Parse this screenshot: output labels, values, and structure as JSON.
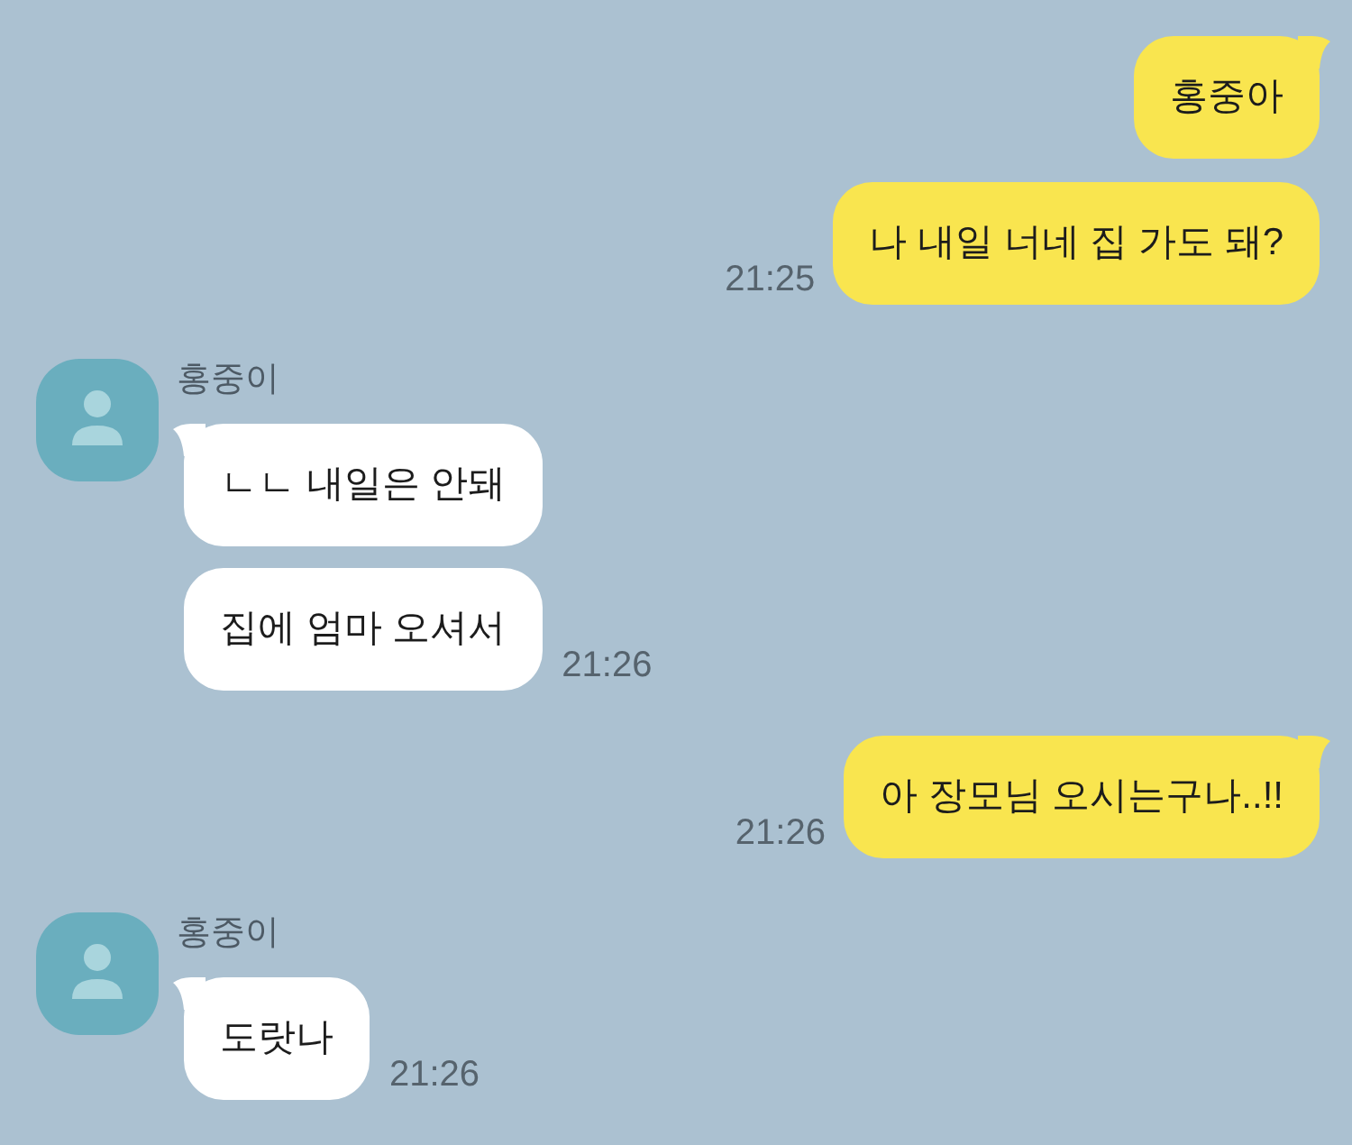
{
  "chat": [
    {
      "kind": "outgoing",
      "bubbles": [
        "홍중아",
        "나 내일 너네 집 가도 돼?"
      ],
      "time": "21:25"
    },
    {
      "kind": "incoming",
      "sender": "홍중이",
      "bubbles": [
        "ㄴㄴ 내일은 안돼",
        "집에 엄마 오셔서"
      ],
      "time": "21:26"
    },
    {
      "kind": "outgoing",
      "bubbles": [
        "아 장모님 오시는구나..!!"
      ],
      "time": "21:26"
    },
    {
      "kind": "incoming",
      "sender": "홍중이",
      "bubbles": [
        "도랏나"
      ],
      "time": "21:26"
    }
  ]
}
